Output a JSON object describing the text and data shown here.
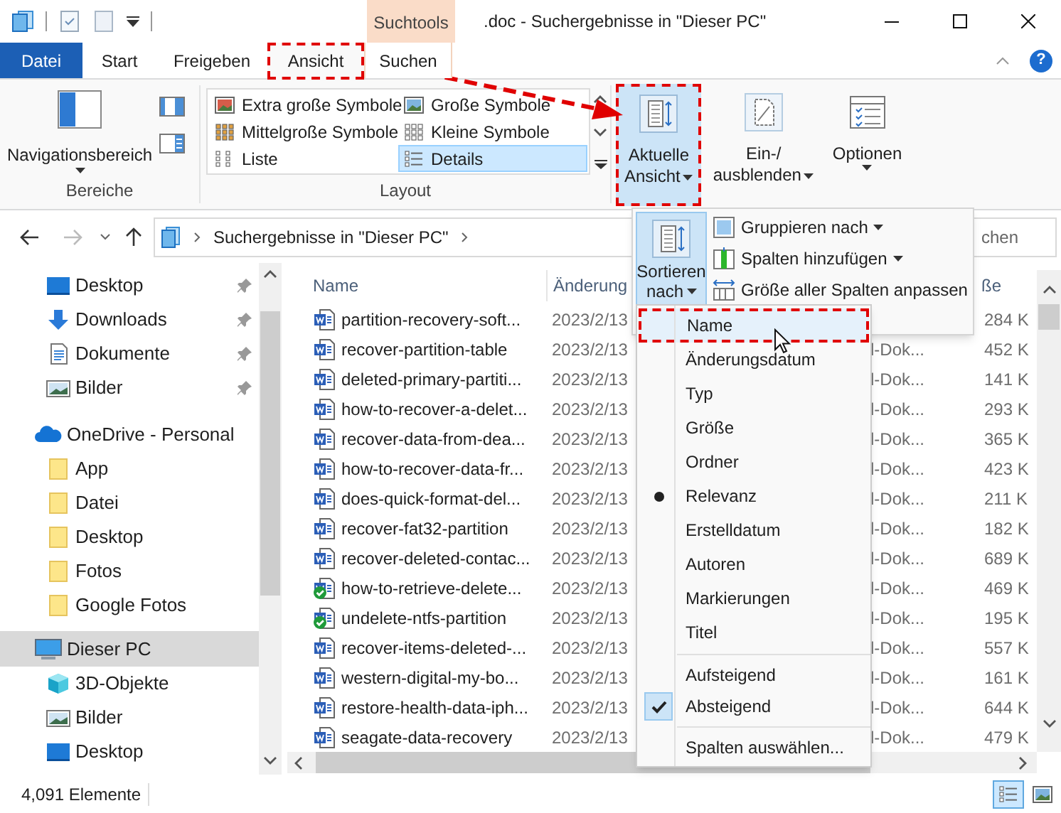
{
  "title_bar": {
    "context_tab": "Suchtools",
    "title": ".doc - Suchergebnisse in \"Dieser PC\""
  },
  "ribbon_tabs": [
    {
      "label": "Datei",
      "kind": "file",
      "annotated": false
    },
    {
      "label": "Start",
      "kind": "tab",
      "selected": false,
      "annotated": false
    },
    {
      "label": "Freigeben",
      "kind": "tab",
      "selected": false,
      "annotated": false
    },
    {
      "label": "Ansicht",
      "kind": "tab",
      "selected": true,
      "annotated": true
    },
    {
      "label": "Suchen",
      "kind": "context",
      "selected": false,
      "annotated": false
    }
  ],
  "help_label": "?",
  "panes_group": {
    "label": "Bereiche",
    "button": "Navigationsbereich"
  },
  "layout_group": {
    "label": "Layout",
    "options": [
      {
        "label": "Extra große Symbole",
        "kind": "extra-large",
        "selected": false
      },
      {
        "label": "Große Symbole",
        "kind": "large",
        "selected": false
      },
      {
        "label": "Mittelgroße Symbole",
        "kind": "medium",
        "selected": false
      },
      {
        "label": "Kleine Symbole",
        "kind": "small",
        "selected": false
      },
      {
        "label": "Liste",
        "kind": "list",
        "selected": false
      },
      {
        "label": "Details",
        "kind": "details",
        "selected": true
      }
    ]
  },
  "view_buttons": [
    {
      "lines": [
        "Aktuelle",
        "Ansicht"
      ],
      "kind": "current-view",
      "selected": true,
      "annotated": true
    },
    {
      "lines": [
        "Ein-/",
        "ausblenden"
      ],
      "kind": "show-hide",
      "selected": false,
      "annotated": false
    },
    {
      "lines": [
        "Optionen"
      ],
      "kind": "options",
      "selected": false,
      "annotated": false
    }
  ],
  "address_bar": {
    "path": "Suchergebnisse in \"Dieser PC\"",
    "search_text": "chen"
  },
  "nav_pane": {
    "quick_access": [
      {
        "label": "Desktop",
        "kind": "desktop",
        "pinned": true
      },
      {
        "label": "Downloads",
        "kind": "downloads",
        "pinned": true
      },
      {
        "label": "Dokumente",
        "kind": "documents",
        "pinned": true
      },
      {
        "label": "Bilder",
        "kind": "pictures",
        "pinned": true
      }
    ],
    "trees": [
      {
        "label": "OneDrive - Personal",
        "kind": "cloud",
        "selected": false,
        "children": [
          {
            "label": "App",
            "kind": "folder",
            "selected": false
          },
          {
            "label": "Datei",
            "kind": "folder",
            "selected": false
          },
          {
            "label": "Desktop",
            "kind": "folder",
            "selected": false
          },
          {
            "label": "Fotos",
            "kind": "folder",
            "selected": false
          },
          {
            "label": "Google Fotos",
            "kind": "folder",
            "selected": false
          }
        ]
      },
      {
        "label": "Dieser PC",
        "kind": "pc",
        "selected": true,
        "children": [
          {
            "label": "3D-Objekte",
            "kind": "cube",
            "selected": false
          },
          {
            "label": "Bilder",
            "kind": "pictures",
            "selected": false
          },
          {
            "label": "Desktop",
            "kind": "desktop",
            "selected": false
          }
        ]
      }
    ]
  },
  "file_list": {
    "columns": [
      "Name",
      "Änderung",
      "ße"
    ],
    "rows": [
      {
        "name": "partition-recovery-soft...",
        "date": "2023/2/13",
        "size": "284 K",
        "synced": false
      },
      {
        "name": "recover-partition-table",
        "date": "2023/2/13",
        "type": "l-Dok...",
        "size": "452 K",
        "synced": false
      },
      {
        "name": "deleted-primary-partiti...",
        "date": "2023/2/13",
        "type": "l-Dok...",
        "size": "141 K",
        "synced": false
      },
      {
        "name": "how-to-recover-a-delet...",
        "date": "2023/2/13",
        "type": "l-Dok...",
        "size": "293 K",
        "synced": false
      },
      {
        "name": "recover-data-from-dea...",
        "date": "2023/2/13",
        "type": "l-Dok...",
        "size": "365 K",
        "synced": false
      },
      {
        "name": "how-to-recover-data-fr...",
        "date": "2023/2/13",
        "type": "l-Dok...",
        "size": "423 K",
        "synced": false
      },
      {
        "name": "does-quick-format-del...",
        "date": "2023/2/13",
        "type": "l-Dok...",
        "size": "211 K",
        "synced": false
      },
      {
        "name": "recover-fat32-partition",
        "date": "2023/2/13",
        "type": "l-Dok...",
        "size": "182 K",
        "synced": false
      },
      {
        "name": "recover-deleted-contac...",
        "date": "2023/2/13",
        "type": "l-Dok...",
        "size": "689 K",
        "synced": false
      },
      {
        "name": "how-to-retrieve-delete...",
        "date": "2023/2/13",
        "type": "l-Dok...",
        "size": "469 K",
        "synced": true
      },
      {
        "name": "undelete-ntfs-partition",
        "date": "2023/2/13",
        "type": "l-Dok...",
        "size": "195 K",
        "synced": true
      },
      {
        "name": "recover-items-deleted-...",
        "date": "2023/2/13",
        "type": "l-Dok...",
        "size": "557 K",
        "synced": false
      },
      {
        "name": "western-digital-my-bo...",
        "date": "2023/2/13",
        "type": "l-Dok...",
        "size": "161 K",
        "synced": false
      },
      {
        "name": "restore-health-data-iph...",
        "date": "2023/2/13",
        "type": "l-Dok...",
        "size": "644 K",
        "synced": false
      },
      {
        "name": "seagate-data-recovery",
        "date": "2023/2/13",
        "type": "l-Dok...",
        "size": "479 K",
        "synced": false
      }
    ]
  },
  "current_view_panel": {
    "sort_button": [
      "Sortieren",
      "nach"
    ],
    "options": [
      {
        "label": "Gruppieren nach",
        "kind": "group",
        "dropdown": true
      },
      {
        "label": "Spalten hinzufügen",
        "kind": "add-columns",
        "dropdown": true
      },
      {
        "label": "Größe aller Spalten anpassen",
        "kind": "fit-columns",
        "dropdown": false
      }
    ]
  },
  "sort_menu": [
    {
      "kind": "radio",
      "items": [
        {
          "label": "Name",
          "checked": false,
          "highlighted": true,
          "annotated": true
        },
        {
          "label": "Änderungsdatum",
          "checked": false,
          "highlighted": false,
          "annotated": false
        },
        {
          "label": "Typ",
          "checked": false,
          "highlighted": false,
          "annotated": false
        },
        {
          "label": "Größe",
          "checked": false,
          "highlighted": false,
          "annotated": false
        },
        {
          "label": "Ordner",
          "checked": false,
          "highlighted": false,
          "annotated": false
        },
        {
          "label": "Relevanz",
          "checked": true,
          "highlighted": false,
          "annotated": false
        },
        {
          "label": "Erstelldatum",
          "checked": false,
          "highlighted": false,
          "annotated": false
        },
        {
          "label": "Autoren",
          "checked": false,
          "highlighted": false,
          "annotated": false
        },
        {
          "label": "Markierungen",
          "checked": false,
          "highlighted": false,
          "annotated": false
        },
        {
          "label": "Titel",
          "checked": false,
          "highlighted": false,
          "annotated": false
        }
      ]
    },
    {
      "kind": "check",
      "items": [
        {
          "label": "Aufsteigend",
          "checked": false,
          "highlighted": false,
          "annotated": false
        },
        {
          "label": "Absteigend",
          "checked": true,
          "highlighted": false,
          "annotated": false
        }
      ]
    },
    {
      "kind": "action",
      "items": [
        {
          "label": "Spalten auswählen...",
          "highlighted": false,
          "annotated": false
        }
      ]
    }
  ],
  "status_bar": {
    "item_count": "4,091 Elemente",
    "views": [
      {
        "kind": "details",
        "selected": true
      },
      {
        "kind": "large-icons",
        "selected": false
      }
    ]
  }
}
